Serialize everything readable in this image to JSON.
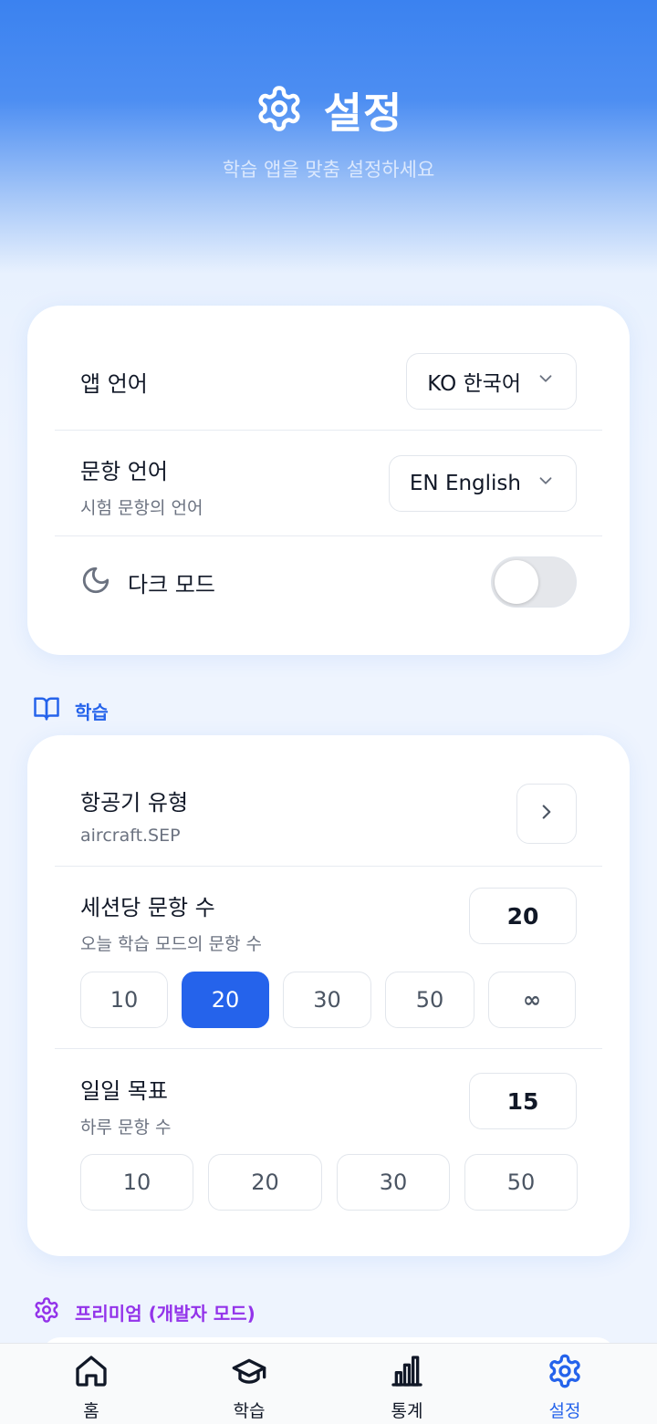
{
  "header": {
    "title": "설정",
    "subtitle": "학습 앱을 맞춤 설정하세요",
    "icon": "gear-icon"
  },
  "general": {
    "app_language": {
      "label": "앱 언어",
      "value": "KO 한국어"
    },
    "question_language": {
      "label": "문항 언어",
      "sublabel": "시험 문항의 언어",
      "value": "EN English"
    },
    "dark_mode": {
      "label": "다크 모드",
      "icon": "moon-icon",
      "enabled": false
    }
  },
  "study_section": {
    "title": "학습",
    "icon": "book-icon",
    "color": "#2563eb",
    "aircraft": {
      "label": "항공기 유형",
      "sublabel": "aircraft.SEP"
    },
    "per_session": {
      "label": "세션당 문항 수",
      "sublabel": "오늘 학습 모드의 문항 수",
      "value": "20",
      "options": [
        "10",
        "20",
        "30",
        "50",
        "∞"
      ],
      "selected": "20"
    },
    "daily_goal": {
      "label": "일일 목표",
      "sublabel": "하루 문항 수",
      "value": "15",
      "options": [
        "10",
        "20",
        "30",
        "50"
      ]
    }
  },
  "premium_section": {
    "title": "프리미엄 (개발자 모드)",
    "icon": "gear-icon",
    "color": "#9333ea"
  },
  "nav": {
    "items": [
      {
        "label": "홈",
        "icon": "home-icon"
      },
      {
        "label": "학습",
        "icon": "graduation-cap-icon"
      },
      {
        "label": "통계",
        "icon": "bar-chart-icon"
      },
      {
        "label": "설정",
        "icon": "gear-icon",
        "active": true
      }
    ],
    "active_color": "#2563eb"
  }
}
